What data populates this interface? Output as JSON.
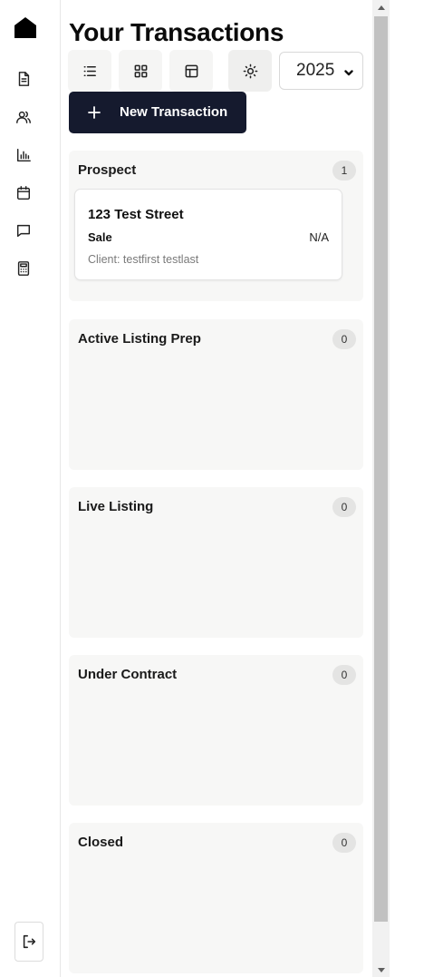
{
  "sidebar": {
    "items": [
      {
        "name": "home-logo-icon"
      },
      {
        "name": "document-icon"
      },
      {
        "name": "users-icon"
      },
      {
        "name": "bar-chart-icon"
      },
      {
        "name": "calendar-icon"
      },
      {
        "name": "message-icon"
      },
      {
        "name": "calculator-icon"
      }
    ],
    "logout_icon": "logout-icon"
  },
  "header": {
    "title": "Your Transactions",
    "view_buttons": [
      "list-view-icon",
      "grid-view-icon",
      "table-view-icon",
      "theme-sun-icon"
    ],
    "year_selected": "2025",
    "new_transaction_label": "New Transaction"
  },
  "columns": [
    {
      "title": "Prospect",
      "count": "1"
    },
    {
      "title": "Active Listing Prep",
      "count": "0"
    },
    {
      "title": "Live Listing",
      "count": "0"
    },
    {
      "title": "Under Contract",
      "count": "0"
    },
    {
      "title": "Closed",
      "count": "0"
    }
  ],
  "card": {
    "address": "123 Test Street",
    "type": "Sale",
    "price": "N/A",
    "client": "Client: testfirst testlast"
  },
  "colors": {
    "primary_button": "#151a2e",
    "column_bg": "#f7f7f6",
    "badge_bg": "#e4e4e3"
  }
}
